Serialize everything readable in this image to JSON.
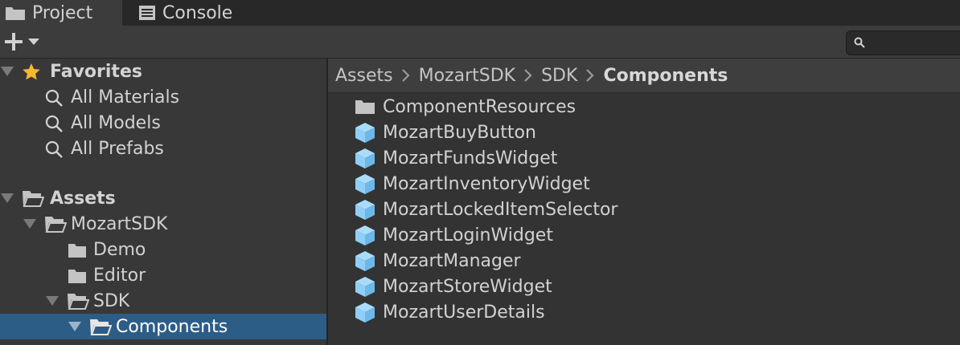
{
  "tabs": [
    {
      "label": "Project",
      "icon": "folder-icon"
    },
    {
      "label": "Console",
      "icon": "console-icon"
    }
  ],
  "toolbar": {
    "add_icon": "plus-icon",
    "dropdown_icon": "chevron-down-icon"
  },
  "search": {
    "placeholder": "",
    "icon": "search-icon"
  },
  "favorites": {
    "title": "Favorites",
    "items": [
      "All Materials",
      "All Models",
      "All Prefabs"
    ]
  },
  "assets": {
    "title": "Assets",
    "tree": {
      "mozart_sdk": "MozartSDK",
      "demo": "Demo",
      "editor": "Editor",
      "sdk": "SDK",
      "components": "Components"
    }
  },
  "breadcrumb": [
    "Assets",
    "MozartSDK",
    "SDK",
    "Components"
  ],
  "files": [
    {
      "name": "ComponentResources",
      "icon": "folder-icon"
    },
    {
      "name": "MozartBuyButton",
      "icon": "prefab-icon"
    },
    {
      "name": "MozartFundsWidget",
      "icon": "prefab-icon"
    },
    {
      "name": "MozartInventoryWidget",
      "icon": "prefab-icon"
    },
    {
      "name": "MozartLockedItemSelector",
      "icon": "prefab-icon"
    },
    {
      "name": "MozartLoginWidget",
      "icon": "prefab-icon"
    },
    {
      "name": "MozartManager",
      "icon": "prefab-icon"
    },
    {
      "name": "MozartStoreWidget",
      "icon": "prefab-icon"
    },
    {
      "name": "MozartUserDetails",
      "icon": "prefab-icon"
    }
  ],
  "colors": {
    "selection": "#2c5d87",
    "prefab": "#8fcff7",
    "star": "#f5b82e"
  }
}
